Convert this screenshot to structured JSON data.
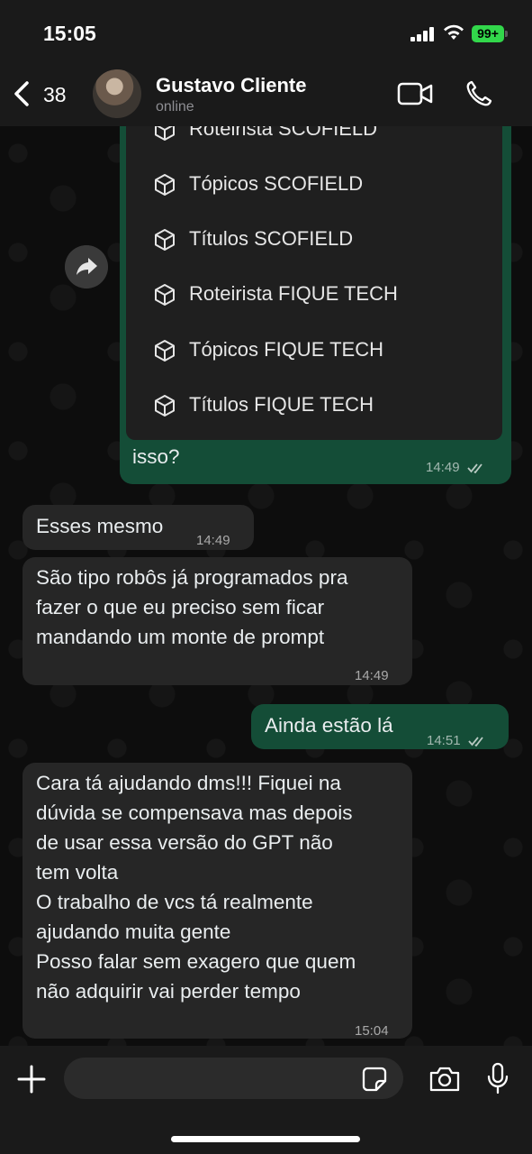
{
  "status_bar": {
    "time": "15:05",
    "battery": "99+"
  },
  "header": {
    "back_count": "38",
    "contact_name": "Gustavo Cliente",
    "contact_status": "online"
  },
  "quoted_image": {
    "items": [
      "Roteirista SCOFIELD",
      "Tópicos SCOFIELD",
      "Títulos SCOFIELD",
      "Roteirista FIQUE TECH",
      "Tópicos FIQUE TECH",
      "Títulos FIQUE TECH"
    ],
    "caption": "isso?",
    "time": "14:49"
  },
  "messages": [
    {
      "direction": "in",
      "text": "Esses mesmo",
      "time": "14:49"
    },
    {
      "direction": "in",
      "text": "São tipo robôs já programados pra\nfazer o que eu preciso sem ficar\nmandando um monte de prompt",
      "time": "14:49"
    },
    {
      "direction": "out",
      "text": "Ainda estão lá",
      "time": "14:51"
    },
    {
      "direction": "in",
      "text": "Cara tá ajudando dms!!! Fiquei na\ndúvida se compensava mas depois\nde usar essa versão do GPT não\ntem volta\nO trabalho de vcs tá realmente\najudando muita gente\nPosso falar sem exagero que quem\nnão adquirir vai perder tempo",
      "time": "15:04"
    }
  ],
  "composer": {
    "placeholder": ""
  },
  "colors": {
    "incoming_bubble": "#262626",
    "outgoing_bubble": "#144d37",
    "battery": "#32d74b"
  }
}
